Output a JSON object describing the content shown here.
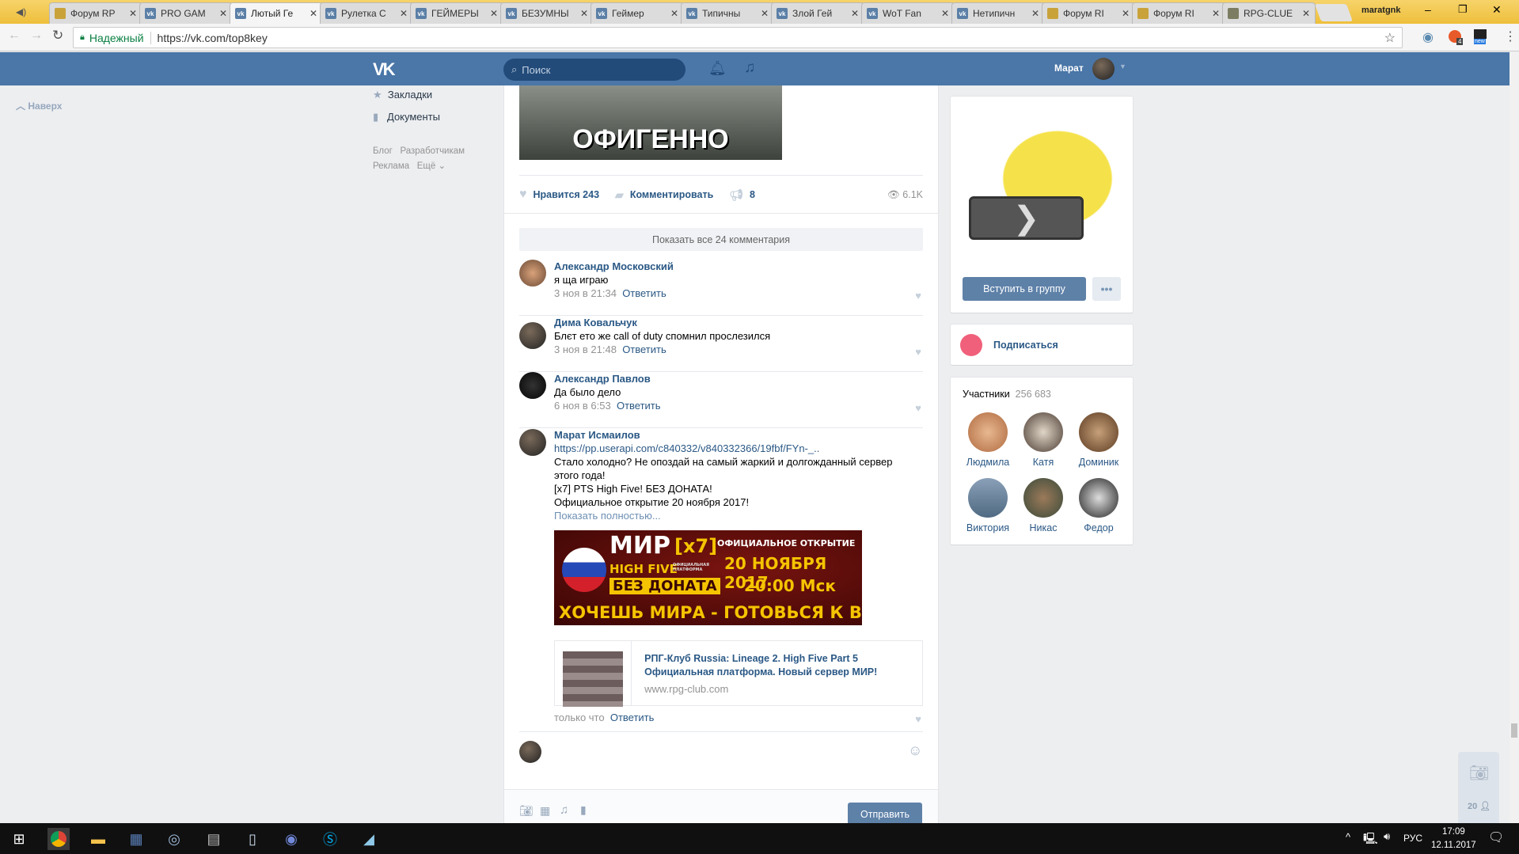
{
  "browser": {
    "tabs": [
      {
        "label": "Форум RP",
        "icon": "forum"
      },
      {
        "label": "PRO GAM",
        "icon": "vk"
      },
      {
        "label": "Лютый Ге",
        "icon": "vk",
        "active": true
      },
      {
        "label": "Рулетка С",
        "icon": "vk"
      },
      {
        "label": "ГЕЙМЕРЫ",
        "icon": "vk"
      },
      {
        "label": "БЕЗУМНЫ",
        "icon": "vk"
      },
      {
        "label": "Геймер",
        "icon": "vk"
      },
      {
        "label": "Типичны",
        "icon": "vk"
      },
      {
        "label": "Злой Гей",
        "icon": "vk"
      },
      {
        "label": "WoT Fan",
        "icon": "vk"
      },
      {
        "label": "Нетипичн",
        "icon": "vk"
      },
      {
        "label": "Форум RI",
        "icon": "forum"
      },
      {
        "label": "Форум RI",
        "icon": "forum"
      },
      {
        "label": "RPG-CLUE",
        "icon": "rpg"
      }
    ],
    "profile_name": "maratgnk",
    "secure_label": "Надежный",
    "url": "https://vk.com/top8key",
    "ext_badge_count": "4",
    "ext_badge_new": "new"
  },
  "header": {
    "search_placeholder": "Поиск",
    "user_name": "Марат"
  },
  "left": {
    "back_to_top": "Наверх",
    "menu": [
      "Закладки",
      "Документы"
    ],
    "footer": [
      "Блог",
      "Разработчикам",
      "Реклама",
      "Ещё"
    ]
  },
  "post": {
    "image_caption": "ОФИГЕННО",
    "like_label": "Нравится",
    "like_count": "243",
    "comment_label": "Комментировать",
    "share_count": "8",
    "views": "6.1K",
    "show_all": "Показать все 24 комментария",
    "comments": [
      {
        "name": "Александр Московский",
        "text": "я ща играю",
        "date": "3 ноя в 21:34",
        "reply": "Ответить"
      },
      {
        "name": "Дима Ковальчук",
        "text": "Блєт ето же call of duty спомнил прослезился",
        "date": "3 ноя в 21:48",
        "reply": "Ответить"
      },
      {
        "name": "Александр Павлов",
        "text": "Да было дело",
        "date": "6 ноя в 6:53",
        "reply": "Ответить"
      }
    ],
    "last_comment": {
      "name": "Марат Исмаилов",
      "link": "https://pp.userapi.com/c840332/v840332366/19fbf/FYn-_..",
      "lines": [
        "Стало холодно? Не опоздай на самый жаркий и долгожданный сервер этого года!",
        "[x7] PTS High Five! БЕЗ ДОНАТА!",
        "Официальное открытие 20 ноября 2017!"
      ],
      "show_more": "Показать полностью...",
      "banner": {
        "title": "МИР",
        "rate": "[x7]",
        "sub": "HIGH FIVE",
        "platform": "ОФИЦИАЛЬНАЯ ПЛАТФОРМА",
        "nodonate": "БЕЗ ДОНАТА",
        "opening": "ОФИЦИАЛЬНОЕ ОТКРЫТИЕ",
        "date": "20 НОЯБРЯ 2017",
        "time": "20:00 Мск",
        "slogan": "ХОЧЕШЬ МИРА - ГОТОВЬСЯ К ВОЙНЕ"
      },
      "card": {
        "title": "РПГ-Клуб Russia: Lineage 2. High Five Part 5 Официальная платформа. Новый сервер МИР!",
        "domain": "www.rpg-club.com"
      },
      "date": "только что",
      "reply": "Ответить"
    },
    "send_label": "Отправить"
  },
  "right": {
    "join_label": "Вступить в группу",
    "subscribe_label": "Подписаться",
    "members_label": "Участники",
    "members_count": "256 683",
    "members": [
      "Людмила",
      "Катя",
      "Доминик",
      "Виктория",
      "Никас",
      "Федор"
    ]
  },
  "chat_widget": {
    "count": "20"
  },
  "taskbar": {
    "lang": "РУС",
    "time": "17:09",
    "date": "12.11.2017"
  }
}
